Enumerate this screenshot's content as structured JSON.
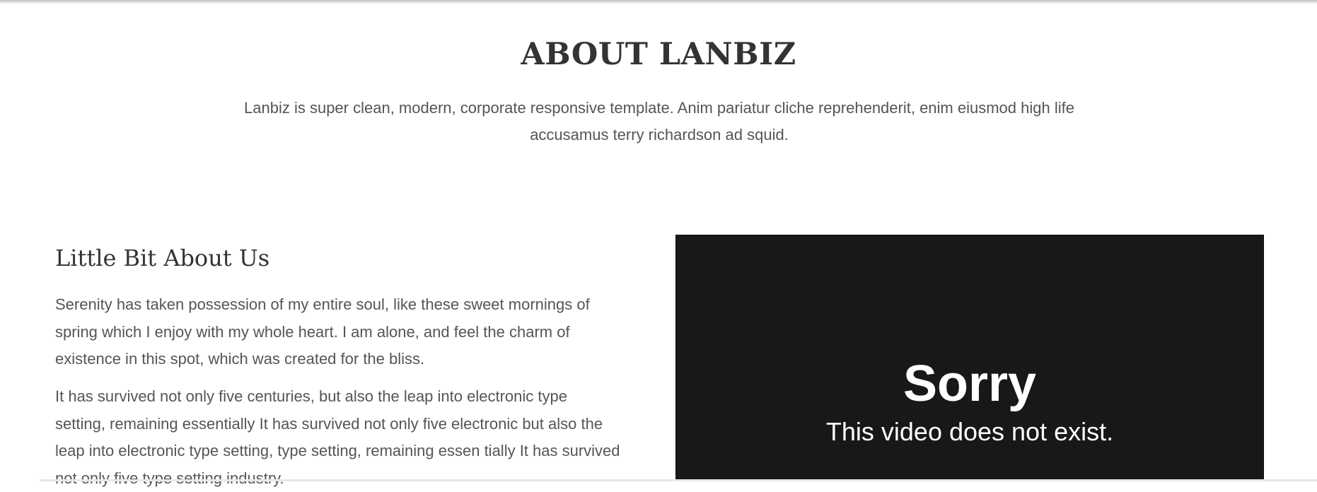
{
  "about": {
    "title": "ABOUT LANBIZ",
    "intro": "Lanbiz is super clean, modern, corporate responsive template. Anim pariatur cliche reprehenderit, enim eiusmod high life accusamus terry richardson ad squid."
  },
  "story": {
    "heading": "Little Bit About Us",
    "paragraphs": [
      "Serenity has taken possession of my entire soul, like these sweet mornings of spring which I enjoy with my whole heart. I am alone, and feel the charm of existence in this spot, which was created for the bliss.",
      "It has survived not only five centuries, but also the leap into electronic type setting, remaining essentially It has survived not only five electronic but also the leap into electronic type setting, type setting, remaining essen tially It has survived not only five type setting industry."
    ]
  },
  "video": {
    "title": "Sorry",
    "message": "This video does not exist."
  },
  "colors": {
    "heading": "#333333",
    "body_text": "#555555",
    "video_background": "#181818",
    "video_text": "#ffffff"
  }
}
